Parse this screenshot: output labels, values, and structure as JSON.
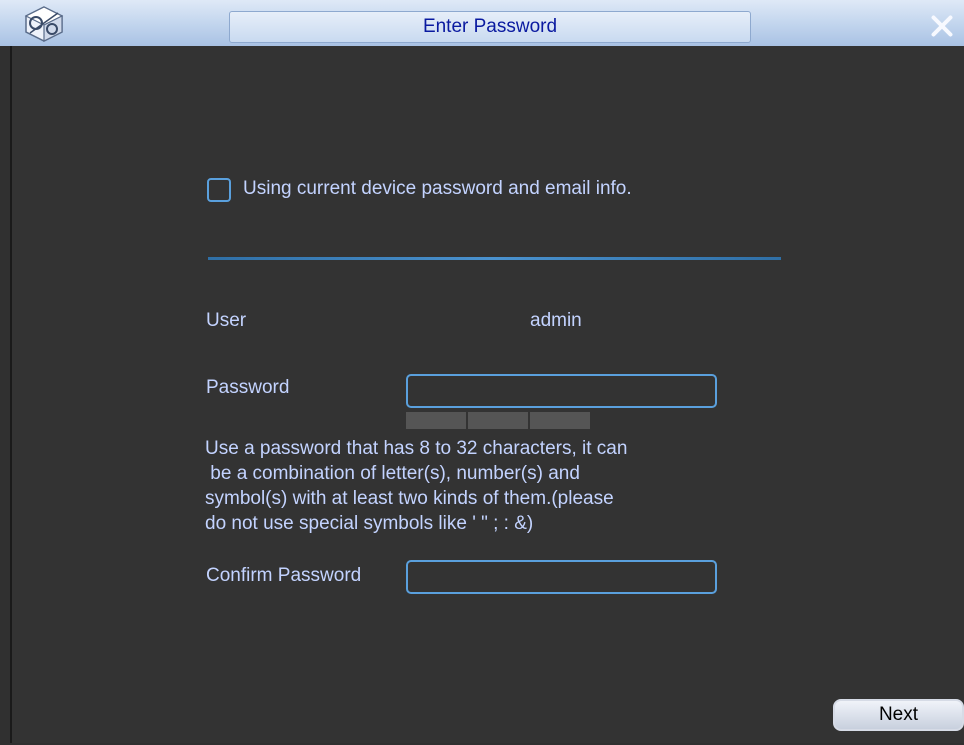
{
  "window": {
    "title": "Enter Password",
    "close_glyph": ""
  },
  "form": {
    "use_current_label": "Using current device password and email info.",
    "use_current_checked": false,
    "user_label": "User",
    "user_value": "admin",
    "password_label": "Password",
    "password_value": "",
    "help_text": "Use a password that has 8 to 32 characters, it can\n be a combination of letter(s), number(s) and\nsymbol(s) with at least two kinds of them.(please\ndo not use special symbols like ' \" ; : &)",
    "confirm_label": "Confirm Password",
    "confirm_value": ""
  },
  "footer": {
    "next_label": "Next"
  },
  "icons": {
    "app_logo": "cube-logo-icon",
    "close": "close-icon"
  },
  "colors": {
    "accent": "#5aa0dd",
    "label_text": "#c3d3ff",
    "title_text": "#0a1aa0",
    "background": "#333333"
  }
}
